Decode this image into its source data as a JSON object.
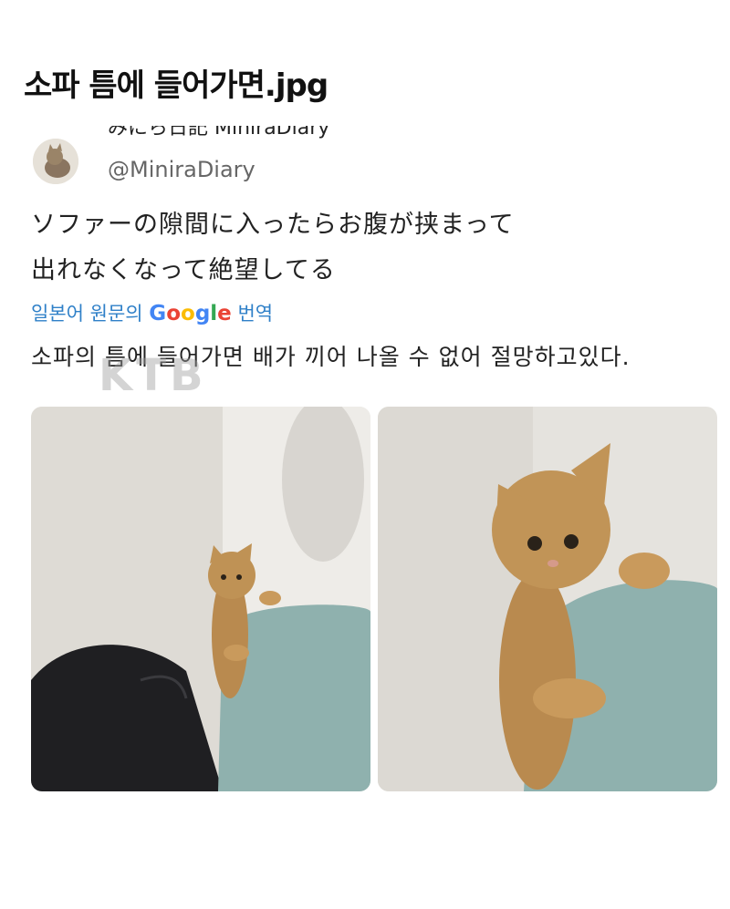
{
  "post": {
    "title": "소파 틈에 들어가면.jpg"
  },
  "tweet": {
    "display_name": "みにら日記 MiniraDiary",
    "handle": "@MiniraDiary",
    "text_line1": "ソファーの隙間に入ったらお腹が挟まって",
    "text_line2": "出れなくなって絶望してる",
    "translation_label_prefix": "일본어 원문의",
    "translation_label_google": "Google",
    "translation_label_suffix": "번역",
    "translation_text": "소파의 틈에 들어가면 배가 끼어 나올 수 없어 절망하고있다.",
    "watermark": "KTB"
  },
  "images": [
    {
      "name": "cat-in-sofa-gap-photo-1"
    },
    {
      "name": "cat-in-sofa-gap-photo-2"
    }
  ],
  "colors": {
    "translation_link": "#2f80c8",
    "sofa": "#8fb1ae",
    "wall": "#e8e6e1",
    "cat": "#b98a4f"
  }
}
